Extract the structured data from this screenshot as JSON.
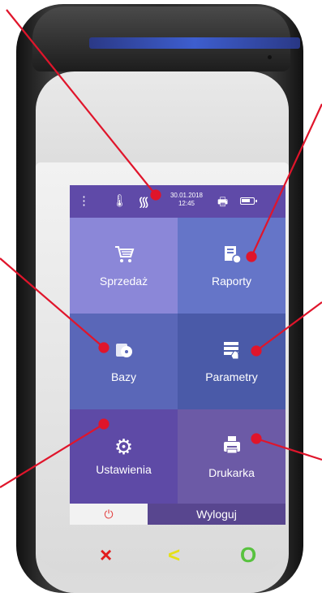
{
  "status_bar": {
    "menu_icon": "vertical-dots-icon",
    "signal_icon": "thermometer-signal-icon",
    "wifi_icon": "wifi-icon",
    "date": "30.01.2018",
    "time": "12:45",
    "printer_icon": "printer-icon",
    "battery_icon": "battery-icon"
  },
  "tiles": [
    {
      "label": "Sprzedaż",
      "icon": "cart-icon"
    },
    {
      "label": "Raporty",
      "icon": "report-icon"
    },
    {
      "label": "Bazy",
      "icon": "database-icon"
    },
    {
      "label": "Parametry",
      "icon": "parameters-icon"
    },
    {
      "label": "Ustawienia",
      "icon": "gear-icon"
    },
    {
      "label": "Drukarka",
      "icon": "printer-icon"
    }
  ],
  "bottom": {
    "power_icon": "power-icon",
    "logout_label": "Wyloguj"
  },
  "hardware_keys": {
    "cancel": "×",
    "back": "<",
    "ok": "O"
  },
  "colors": {
    "status_bar": "#5f4aa8",
    "callout": "#e0152b",
    "logout": "#58468f"
  }
}
